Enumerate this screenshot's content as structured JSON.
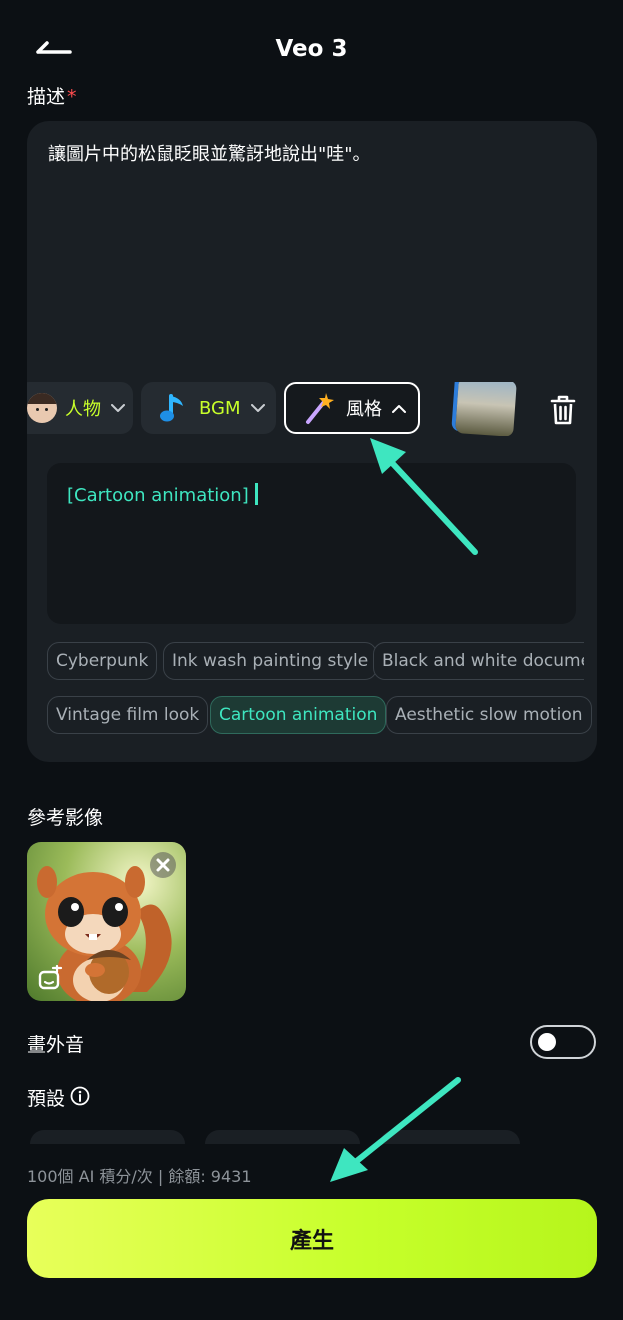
{
  "header": {
    "title": "Veo 3"
  },
  "description": {
    "label": "描述",
    "required_mark": "*",
    "text": "讓圖片中的松鼠眨眼並驚訝地說出\"哇\"。"
  },
  "chips": [
    {
      "label": "人物",
      "icon": "person-avatar-icon",
      "state": "collapsed"
    },
    {
      "label": "BGM",
      "icon": "music-note-icon",
      "state": "collapsed"
    },
    {
      "label": "風格",
      "icon": "magic-wand-icon",
      "state": "expanded"
    }
  ],
  "style_input": {
    "value": "[Cartoon animation]"
  },
  "style_tags": [
    {
      "label": "Cyberpunk",
      "selected": false
    },
    {
      "label": "Ink wash painting style",
      "selected": false
    },
    {
      "label": "Black and white documer",
      "selected": false
    },
    {
      "label": "Vintage film look",
      "selected": false
    },
    {
      "label": "Cartoon animation",
      "selected": true
    },
    {
      "label": "Aesthetic slow motion",
      "selected": false
    }
  ],
  "reference": {
    "label": "參考影像"
  },
  "offscreen_audio": {
    "label": "畫外音",
    "enabled": false
  },
  "preset": {
    "label": "預設"
  },
  "credits": {
    "text": "100個 AI 積分/次 | 餘額: 9431"
  },
  "generate": {
    "label": "產生"
  },
  "colors": {
    "accent_lime": "#c6ff2a",
    "accent_teal": "#3ee6c0",
    "background": "#0c1014",
    "card": "#1a1f24"
  }
}
